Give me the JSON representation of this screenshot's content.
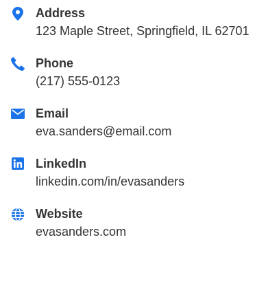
{
  "accent_color": "#1a73e8",
  "contacts": [
    {
      "icon": "map-pin-icon",
      "label": "Address",
      "value": "123 Maple Street, Springfield, IL 62701"
    },
    {
      "icon": "phone-icon",
      "label": "Phone",
      "value": "(217) 555-0123"
    },
    {
      "icon": "envelope-icon",
      "label": "Email",
      "value": "eva.sanders@email.com"
    },
    {
      "icon": "linkedin-icon",
      "label": "LinkedIn",
      "value": "linkedin.com/in/evasanders"
    },
    {
      "icon": "globe-icon",
      "label": "Website",
      "value": "evasanders.com"
    }
  ]
}
